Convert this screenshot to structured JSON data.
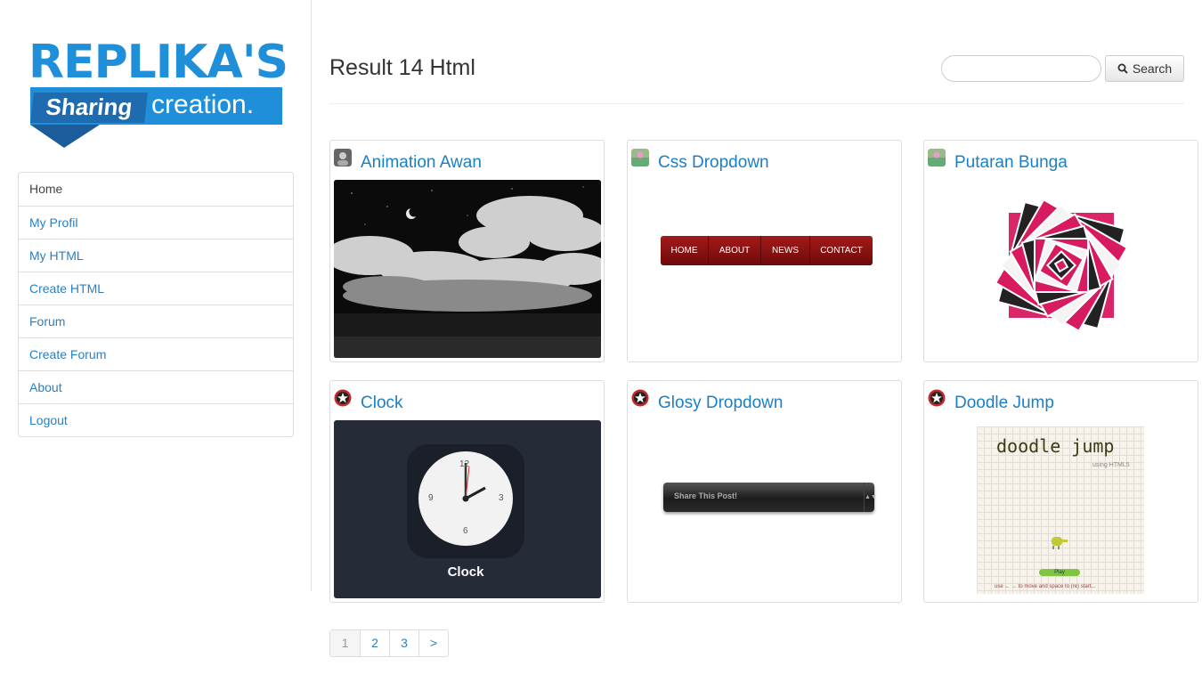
{
  "logo": {
    "line1": "REPLIKA'S",
    "line2a": "Sharing",
    "line2b": "creation."
  },
  "nav": [
    {
      "label": "Home"
    },
    {
      "label": "My Profil"
    },
    {
      "label": "My HTML"
    },
    {
      "label": "Create HTML"
    },
    {
      "label": "Forum"
    },
    {
      "label": "Create Forum"
    },
    {
      "label": "About"
    },
    {
      "label": "Logout"
    }
  ],
  "main": {
    "title": "Result 14 Html",
    "search": {
      "placeholder": "",
      "button": "Search"
    }
  },
  "cards": [
    {
      "title": "Animation Awan",
      "avatar": "profile-avatar"
    },
    {
      "title": "Css Dropdown",
      "avatar": "profile-avatar",
      "menu": [
        "HOME",
        "ABOUT",
        "NEWS",
        "CONTACT"
      ]
    },
    {
      "title": "Putaran Bunga",
      "avatar": "profile-avatar"
    },
    {
      "title": "Clock",
      "avatar": "star-badge-avatar",
      "caption": "Clock",
      "numbers": [
        "12",
        "3",
        "6",
        "9"
      ]
    },
    {
      "title": "Glosy Dropdown",
      "avatar": "star-badge-avatar",
      "select": "Share This Post!"
    },
    {
      "title": "Doodle Jump",
      "avatar": "star-badge-avatar",
      "game_title": "doodle jump",
      "subtitle": "using HTML5",
      "play": "Play",
      "footer": "use ← → to move and space to (re) start..."
    }
  ],
  "pagination": [
    "1",
    "2",
    "3",
    ">"
  ],
  "colors": {
    "accent": "#1b7fc4",
    "logo": "#1e8fd8",
    "dropdown": "#8b1010"
  }
}
